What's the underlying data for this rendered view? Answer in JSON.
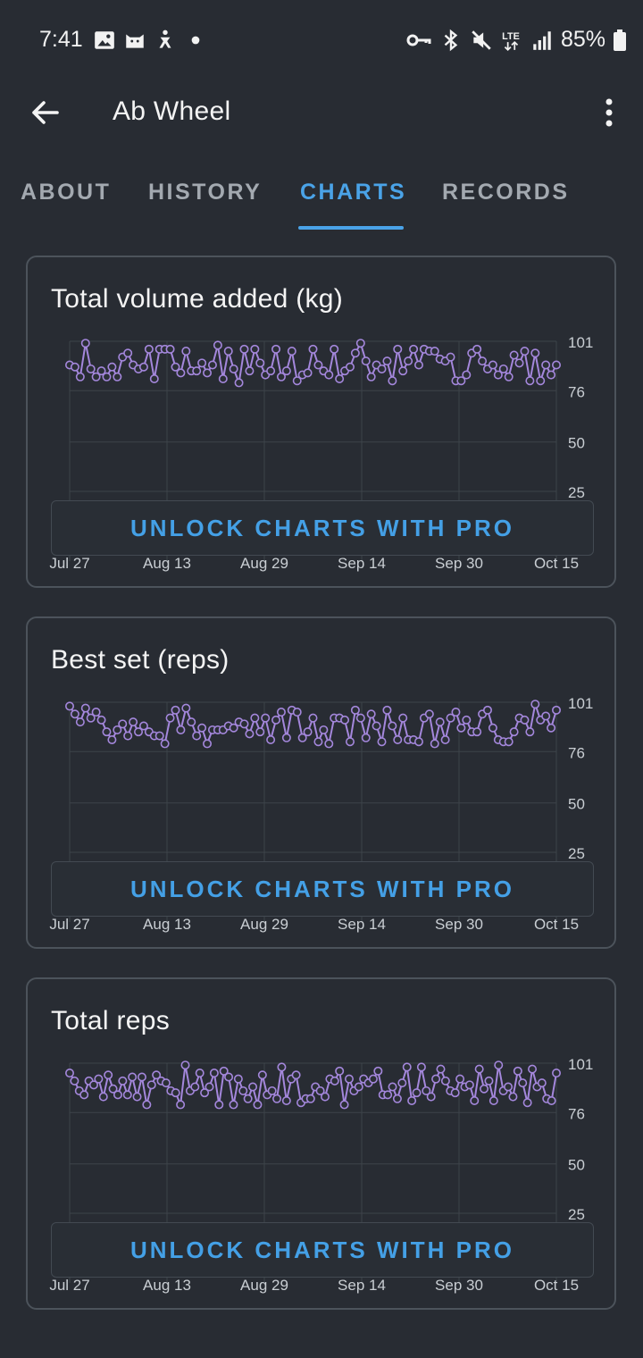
{
  "status_bar": {
    "time": "7:41",
    "battery": "85%",
    "icons": [
      "gallery-icon",
      "cat-icon",
      "fitness-icon",
      "dot-icon",
      "vpn-key-icon",
      "bluetooth-icon",
      "mute-icon",
      "lte-icon",
      "signal-icon",
      "battery-icon"
    ]
  },
  "app_bar": {
    "title": "Ab Wheel"
  },
  "tabs": [
    {
      "label": "ABOUT",
      "active": false
    },
    {
      "label": "HISTORY",
      "active": false
    },
    {
      "label": "CHARTS",
      "active": true
    },
    {
      "label": "RECORDS",
      "active": false
    }
  ],
  "colors": {
    "accent": "#4aa3e8",
    "series": "#a487dc",
    "background": "#282c33"
  },
  "cards": [
    {
      "title": "Total volume added (kg)",
      "unlock_label": "UNLOCK CHARTS WITH PRO"
    },
    {
      "title": "Best set (reps)",
      "unlock_label": "UNLOCK CHARTS WITH PRO"
    },
    {
      "title": "Total reps",
      "unlock_label": "UNLOCK CHARTS WITH PRO"
    }
  ],
  "chart_data": [
    {
      "type": "line",
      "title": "Total volume added (kg)",
      "x": [
        "Jul 27",
        "Aug 13",
        "Aug 29",
        "Sep 14",
        "Sep 30",
        "Oct 15"
      ],
      "y_ticks": [
        "101",
        "76",
        "50",
        "25"
      ],
      "ylim": [
        25,
        101
      ],
      "series": [
        {
          "values": [
            89,
            88,
            83,
            100,
            87,
            83,
            86,
            83,
            88,
            83,
            93,
            95,
            89,
            87,
            88,
            97,
            82,
            97,
            97,
            97,
            88,
            85,
            96,
            86,
            86,
            90,
            85,
            89,
            99,
            82,
            96,
            87,
            80,
            97,
            86,
            97,
            90,
            84,
            86,
            97,
            83,
            86,
            96,
            81,
            84,
            85,
            97,
            89,
            86,
            84,
            97,
            82,
            86,
            88,
            95,
            100,
            91,
            83,
            89,
            87,
            91,
            81,
            97,
            86,
            91,
            97,
            89,
            97,
            96,
            96,
            92,
            91,
            93,
            81,
            81,
            84,
            95,
            97,
            91,
            87,
            89,
            84,
            87,
            83,
            94,
            90,
            96,
            81,
            95,
            81,
            89,
            84,
            89
          ]
        }
      ]
    },
    {
      "type": "line",
      "title": "Best set (reps)",
      "x": [
        "Jul 27",
        "Aug 13",
        "Aug 29",
        "Sep 14",
        "Sep 30",
        "Oct 15"
      ],
      "y_ticks": [
        "101",
        "76",
        "50",
        "25"
      ],
      "ylim": [
        25,
        101
      ],
      "series": [
        {
          "values": [
            99,
            95,
            91,
            98,
            93,
            96,
            92,
            86,
            82,
            87,
            90,
            84,
            91,
            86,
            89,
            86,
            84,
            84,
            80,
            93,
            97,
            87,
            98,
            91,
            84,
            88,
            80,
            87,
            87,
            87,
            89,
            88,
            91,
            90,
            85,
            93,
            86,
            93,
            82,
            92,
            96,
            83,
            97,
            96,
            83,
            86,
            93,
            81,
            87,
            80,
            93,
            93,
            92,
            81,
            97,
            93,
            83,
            95,
            89,
            81,
            97,
            89,
            82,
            93,
            82,
            82,
            81,
            93,
            95,
            80,
            91,
            82,
            93,
            96,
            88,
            92,
            86,
            86,
            95,
            97,
            88,
            82,
            81,
            81,
            86,
            93,
            92,
            86,
            100,
            92,
            94,
            88,
            97
          ]
        }
      ]
    },
    {
      "type": "line",
      "title": "Total reps",
      "x": [
        "Jul 27",
        "Aug 13",
        "Aug 29",
        "Sep 14",
        "Sep 30",
        "Oct 15"
      ],
      "y_ticks": [
        "101",
        "76",
        "50",
        "25"
      ],
      "ylim": [
        25,
        101
      ],
      "series": [
        {
          "values": [
            96,
            92,
            87,
            85,
            92,
            90,
            93,
            84,
            95,
            88,
            85,
            92,
            85,
            94,
            84,
            94,
            80,
            90,
            95,
            92,
            91,
            87,
            86,
            80,
            100,
            87,
            89,
            96,
            86,
            89,
            96,
            80,
            97,
            94,
            80,
            93,
            87,
            83,
            89,
            80,
            95,
            85,
            87,
            83,
            99,
            82,
            93,
            95,
            81,
            83,
            83,
            89,
            87,
            84,
            93,
            92,
            97,
            80,
            93,
            87,
            89,
            93,
            91,
            93,
            97,
            85,
            85,
            89,
            83,
            91,
            99,
            82,
            86,
            99,
            87,
            84,
            93,
            98,
            92,
            87,
            86,
            93,
            89,
            90,
            82,
            98,
            88,
            92,
            82,
            100,
            87,
            89,
            84,
            97,
            91,
            81,
            98,
            89,
            91,
            83,
            82,
            96
          ]
        }
      ]
    }
  ]
}
